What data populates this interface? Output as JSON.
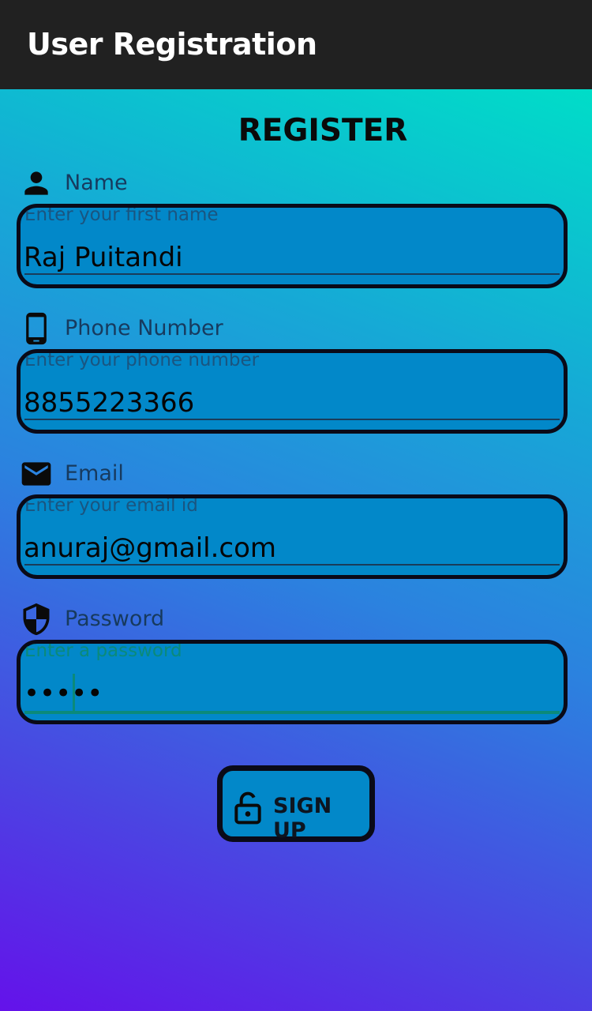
{
  "appbar": {
    "title": "User Registration"
  },
  "form": {
    "heading": "REGISTER",
    "name": {
      "label": "Name",
      "placeholder": "Enter your first name",
      "value": "Raj Puitandi",
      "icon": "person-icon"
    },
    "phone": {
      "label": "Phone Number",
      "placeholder": "Enter your phone number",
      "value": "8855223366",
      "icon": "phone-icon"
    },
    "email": {
      "label": "Email",
      "placeholder": "Enter your email id",
      "value": "anuraj@gmail.com",
      "icon": "mail-icon"
    },
    "password": {
      "label": "Password",
      "placeholder": "Enter a password",
      "value": "•••••",
      "icon": "shield-icon"
    }
  },
  "signup_button": {
    "label": "SIGN UP",
    "icon": "lock-open-icon"
  },
  "colors": {
    "appbar": "#212121",
    "field_fill": "#0288c9",
    "field_border": "#0a0a18",
    "focus_accent": "#0b8a7a",
    "gradient_top": "#00ddc8",
    "gradient_bottom": "#6412ea"
  }
}
